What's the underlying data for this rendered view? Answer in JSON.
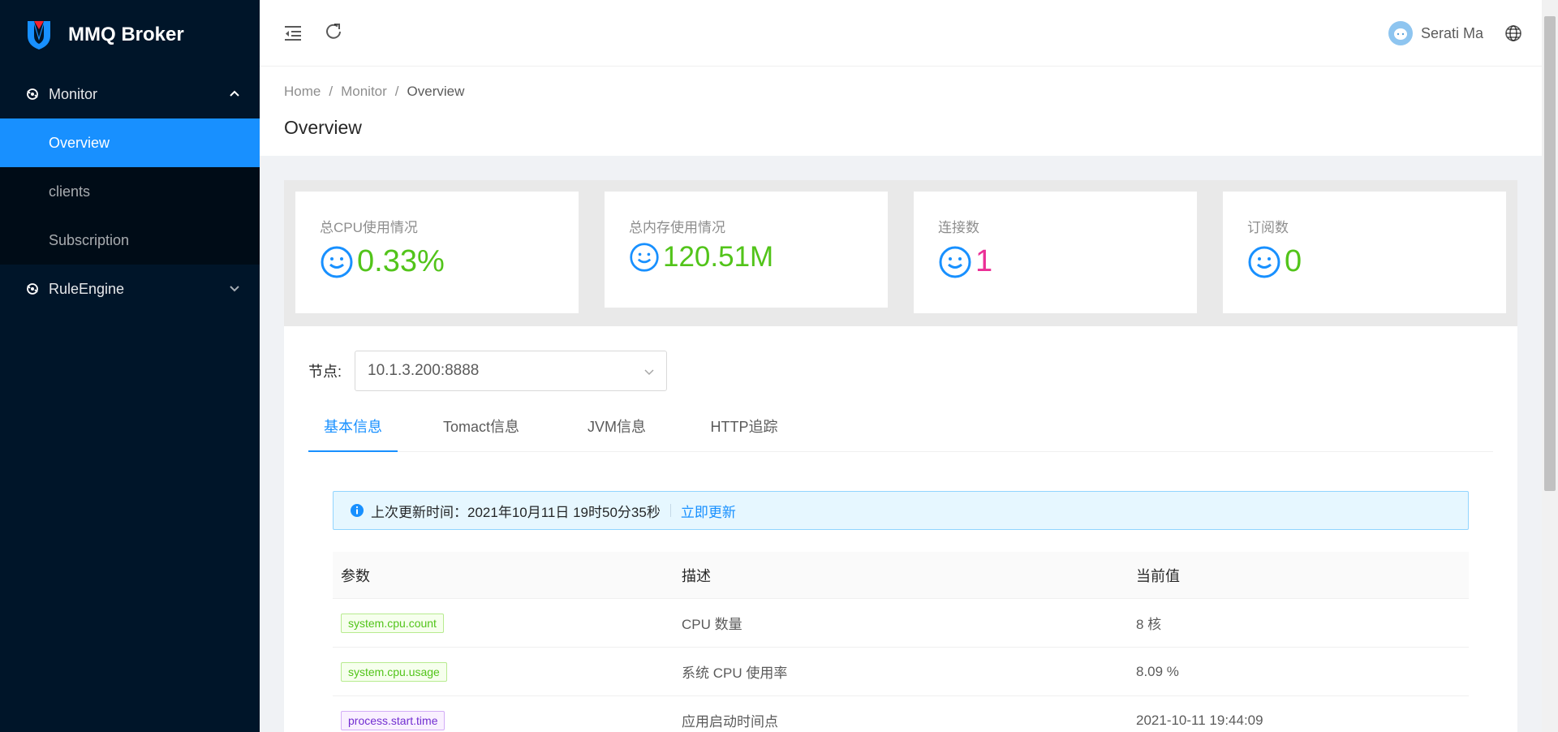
{
  "app": {
    "title": "MMQ Broker"
  },
  "sidebar": {
    "groups": [
      {
        "label": "Monitor",
        "icon": "monitor-icon",
        "expanded": true,
        "items": [
          {
            "label": "Overview",
            "active": true
          },
          {
            "label": "clients"
          },
          {
            "label": "Subscription"
          }
        ]
      },
      {
        "label": "RuleEngine",
        "icon": "rule-engine-icon",
        "expanded": false
      }
    ]
  },
  "header": {
    "username": "Serati Ma",
    "icons": [
      "menu-fold-icon",
      "reload-icon",
      "avatar",
      "globe-icon"
    ]
  },
  "breadcrumb": [
    "Home",
    "Monitor",
    "Overview"
  ],
  "page": {
    "title": "Overview"
  },
  "stats": [
    {
      "label": "总CPU使用情况",
      "value": "0.33%",
      "color": "#52c41a"
    },
    {
      "label": "总内存使用情况",
      "value": "120.51M",
      "color": "#52c41a"
    },
    {
      "label": "连接数",
      "value": "1",
      "color": "#eb2f96"
    },
    {
      "label": "订阅数",
      "value": "0",
      "color": "#52c41a"
    }
  ],
  "node": {
    "label": "节点:",
    "value": "10.1.3.200:8888"
  },
  "tabs": [
    {
      "label": "基本信息",
      "active": true
    },
    {
      "label": "Tomact信息"
    },
    {
      "label": "JVM信息"
    },
    {
      "label": "HTTP追踪"
    }
  ],
  "alert": {
    "text": "上次更新时间：2021年10月11日 19时50分35秒",
    "link": "立即更新"
  },
  "table": {
    "headers": [
      "参数",
      "描述",
      "当前值"
    ],
    "rows": [
      {
        "param": "system.cpu.count",
        "tag_color": "green",
        "desc": "CPU 数量",
        "value": "8 核"
      },
      {
        "param": "system.cpu.usage",
        "tag_color": "green",
        "desc": "系统 CPU 使用率",
        "value": "8.09 %"
      },
      {
        "param": "process.start.time",
        "tag_color": "purple",
        "desc": "应用启动时间点",
        "value": "2021-10-11 19:44:09"
      }
    ]
  },
  "colors": {
    "primary": "#1890ff",
    "sidebar_bg": "#001529",
    "submenu_bg": "#000c17"
  }
}
